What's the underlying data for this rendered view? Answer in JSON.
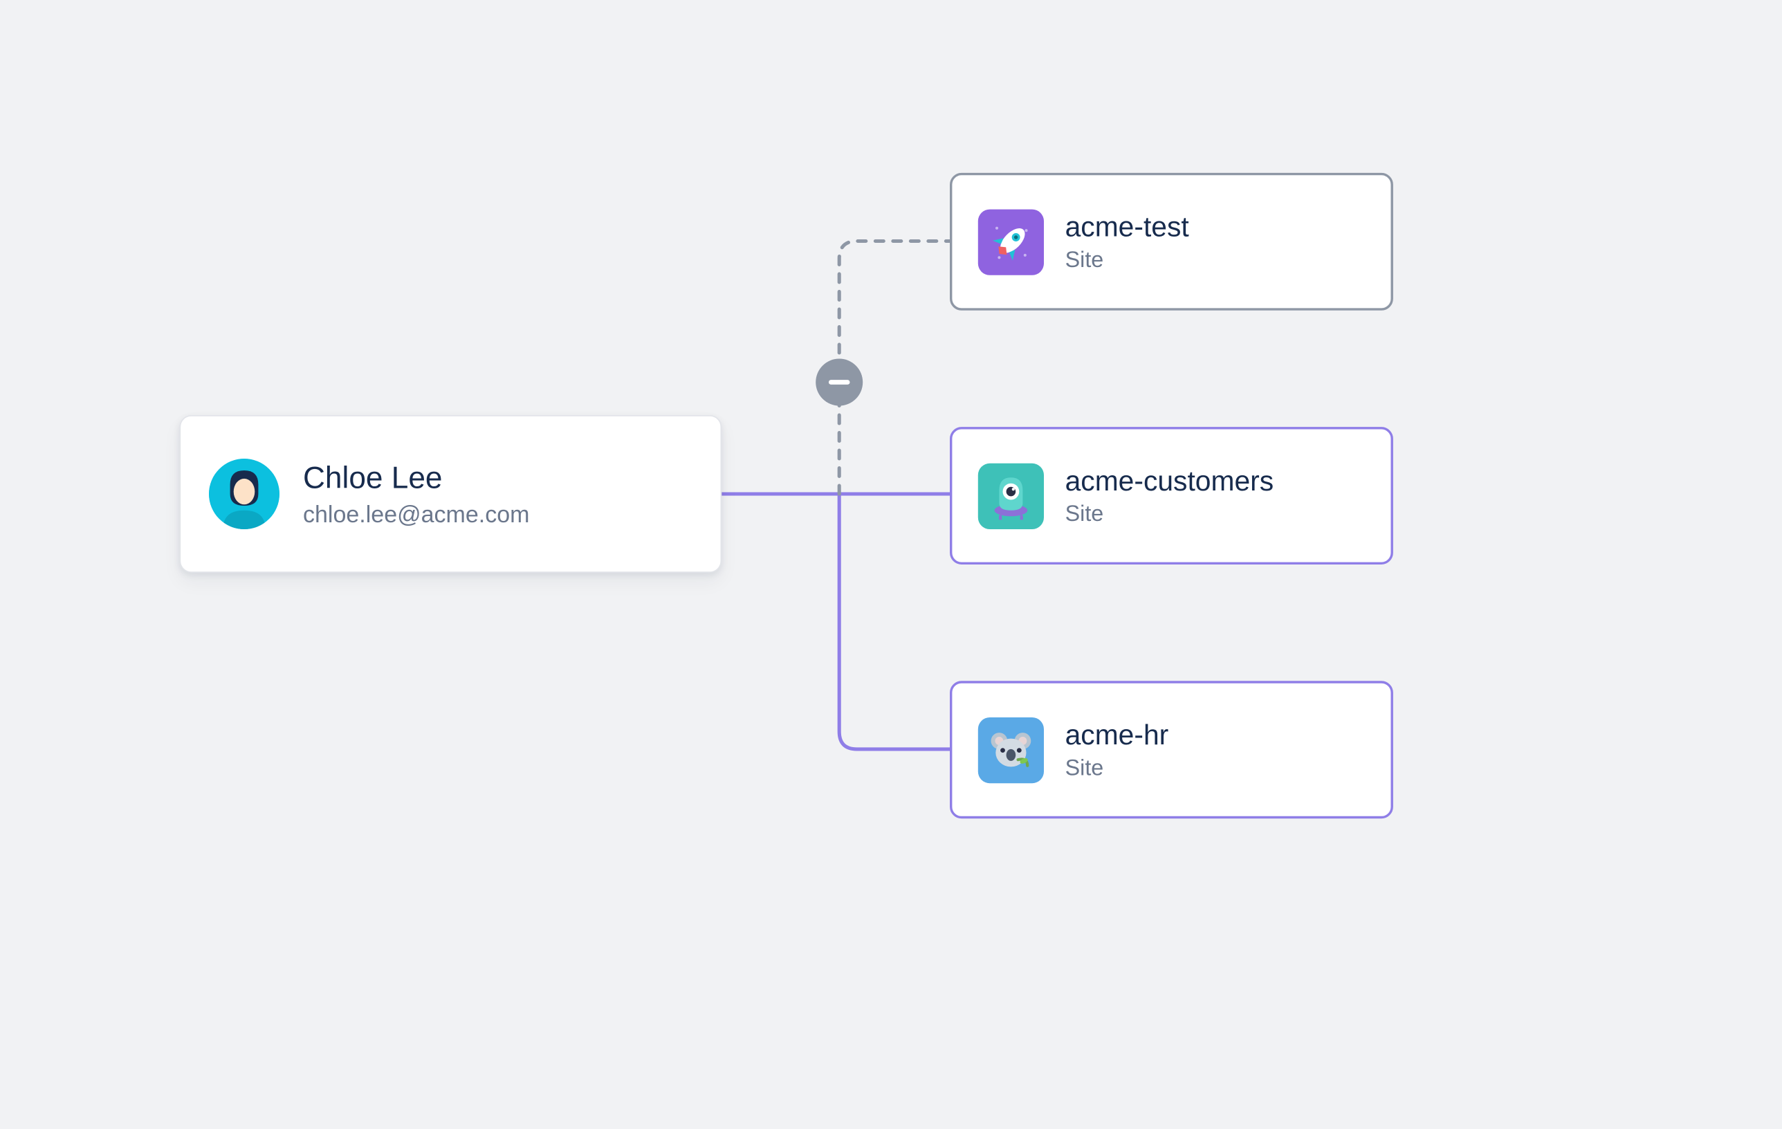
{
  "user": {
    "name": "Chloe Lee",
    "email": "chloe.lee@acme.com"
  },
  "sites": [
    {
      "name": "acme-test",
      "type": "Site",
      "connected": false,
      "icon": "rocket-icon"
    },
    {
      "name": "acme-customers",
      "type": "Site",
      "connected": true,
      "icon": "alien-icon"
    },
    {
      "name": "acme-hr",
      "type": "Site",
      "connected": true,
      "icon": "koala-icon"
    }
  ],
  "colors": {
    "active_border": "#8f7ee7",
    "inactive_border": "#8e97a5",
    "text_primary": "#172b4d",
    "text_secondary": "#6b778c",
    "avatar_bg": "#0cc0df"
  }
}
